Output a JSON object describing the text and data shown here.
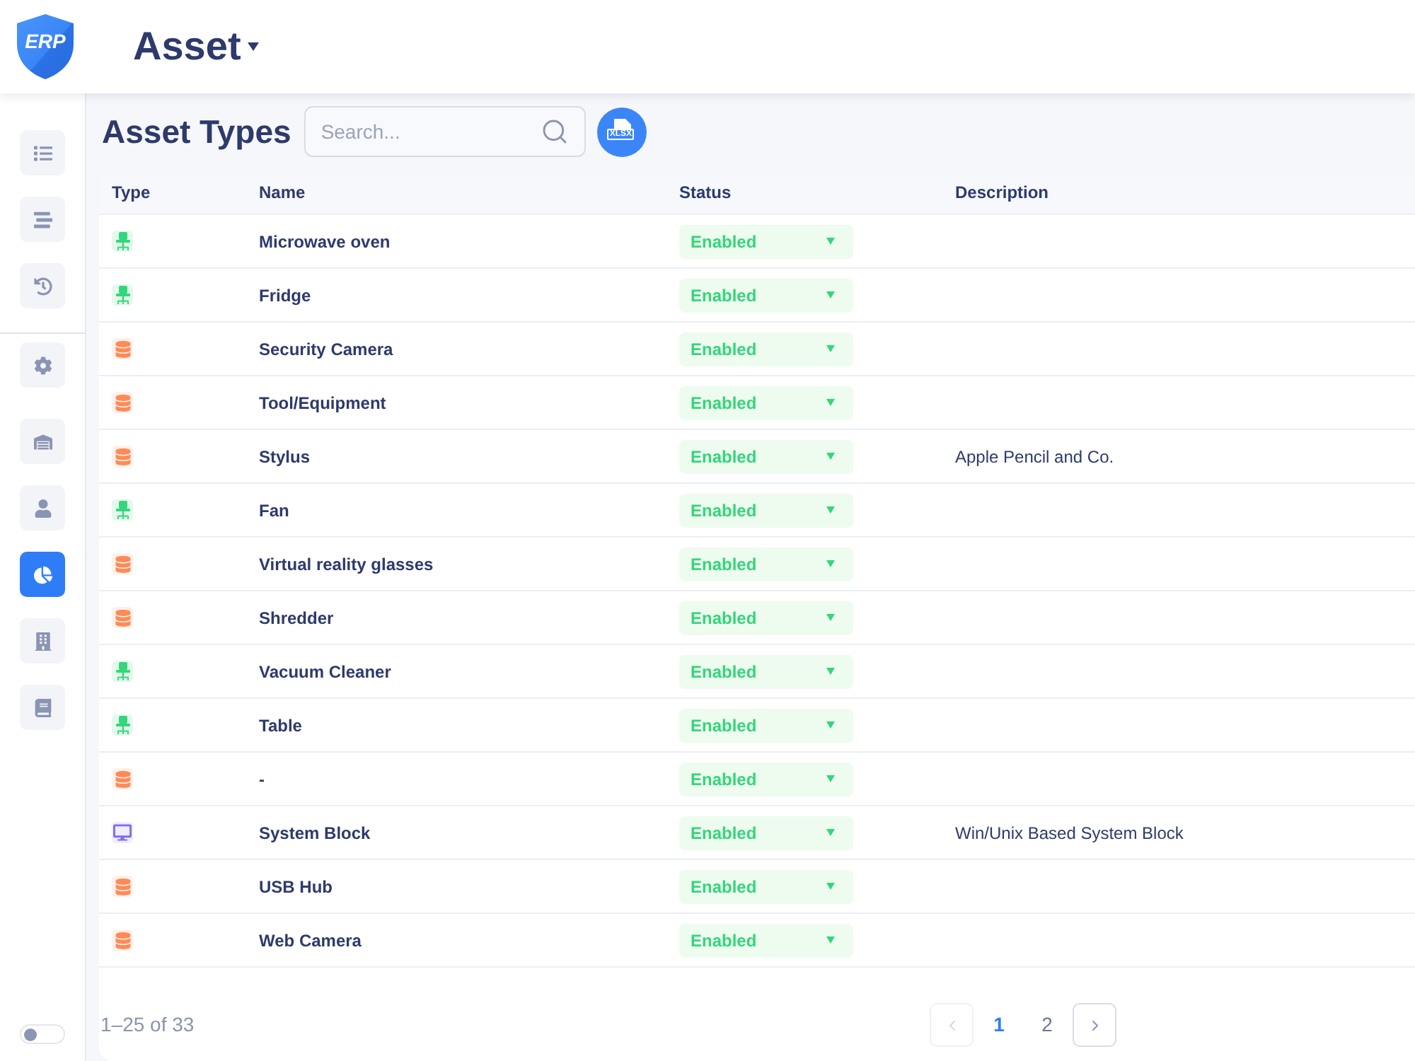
{
  "header": {
    "logo": "ERP",
    "module": {
      "label": "Asset"
    }
  },
  "sidebar": {
    "groups": [
      {
        "divider": true,
        "items": [
          {
            "selected": false
          },
          {
            "selected": false
          },
          {
            "selected": false
          }
        ]
      },
      {
        "divider": false,
        "items": [
          {
            "selected": false
          }
        ]
      },
      {
        "divider": false,
        "items": [
          {
            "selected": false
          },
          {
            "selected": false
          },
          {
            "selected": true
          },
          {
            "selected": false
          },
          {
            "selected": false
          }
        ]
      }
    ],
    "theme_toggle": {
      "on": false
    }
  },
  "page": {
    "title": "Asset Types",
    "search": {
      "placeholder": "Search..."
    },
    "export_button": {
      "label": "XLSX"
    }
  },
  "table": {
    "columns": [
      "Type",
      "Name",
      "Status",
      "Description"
    ],
    "rows": [
      {
        "type": {
          "kind": "chair"
        },
        "name": "Microwave oven",
        "status": "Enabled"
      },
      {
        "type": {
          "kind": "chair"
        },
        "name": "Fridge",
        "status": "Enabled"
      },
      {
        "type": {
          "kind": "database"
        },
        "name": "Security Camera",
        "status": "Enabled"
      },
      {
        "type": {
          "kind": "database"
        },
        "name": "Tool/Equipment",
        "status": "Enabled"
      },
      {
        "type": {
          "kind": "database"
        },
        "name": "Stylus",
        "status": "Enabled",
        "description": "Apple Pencil and Co."
      },
      {
        "type": {
          "kind": "chair"
        },
        "name": "Fan",
        "status": "Enabled"
      },
      {
        "type": {
          "kind": "database"
        },
        "name": "Virtual reality glasses",
        "status": "Enabled"
      },
      {
        "type": {
          "kind": "database"
        },
        "name": "Shredder",
        "status": "Enabled"
      },
      {
        "type": {
          "kind": "chair"
        },
        "name": "Vacuum Cleaner",
        "status": "Enabled"
      },
      {
        "type": {
          "kind": "chair"
        },
        "name": "Table",
        "status": "Enabled"
      },
      {
        "type": {
          "kind": "database"
        },
        "name": "-",
        "status": "Enabled"
      },
      {
        "type": {
          "kind": "monitor"
        },
        "name": "System Block",
        "status": "Enabled",
        "description": "Win/Unix Based System Block"
      },
      {
        "type": {
          "kind": "database"
        },
        "name": "USB Hub",
        "status": "Enabled"
      },
      {
        "type": {
          "kind": "database"
        },
        "name": "Web Camera",
        "status": "Enabled"
      }
    ]
  },
  "pagination": {
    "summary": "1–25 of 33",
    "previous": {
      "disabled": true
    },
    "pages": [
      {
        "label": "1",
        "selected": true
      },
      {
        "label": "2",
        "selected": false
      }
    ],
    "next": {
      "disabled": false
    }
  }
}
